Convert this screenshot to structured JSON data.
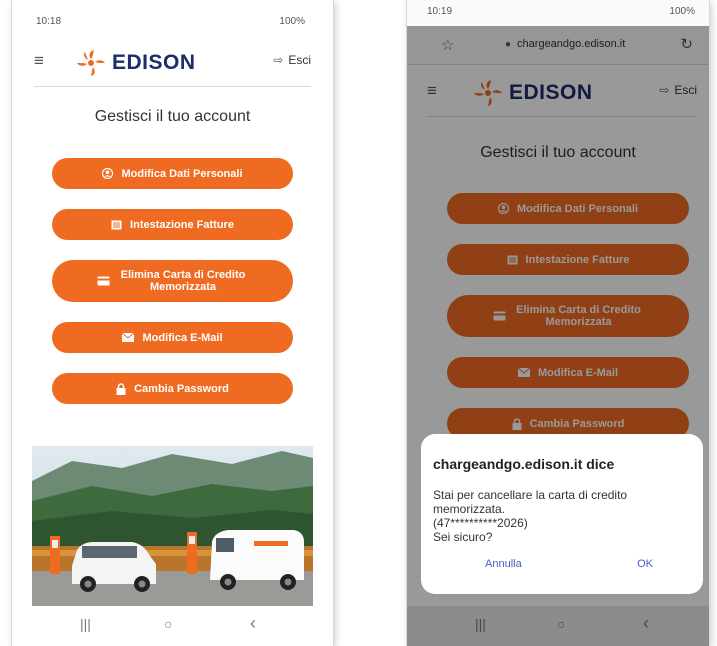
{
  "colors": {
    "accent": "#f06b22",
    "brand_blue": "#1a2d6c",
    "dialog_button": "#4a5bc4"
  },
  "left_phone": {
    "status_bar": {
      "time": "10:18",
      "battery": "100%"
    },
    "header": {
      "brand": "EDISON",
      "menu_icon": "hamburger-icon",
      "logout_label": "Esci",
      "logout_icon": "sign-out-icon"
    },
    "title": "Gestisci il tuo account",
    "buttons": [
      {
        "label": "Modifica Dati Personali",
        "icon": "user-icon"
      },
      {
        "label": "Intestazione Fatture",
        "icon": "invoice-icon"
      },
      {
        "label": "Elimina Carta di Credito Memorizzata",
        "icon": "credit-card-icon"
      },
      {
        "label": "Modifica E-Mail",
        "icon": "envelope-icon"
      },
      {
        "label": "Cambia Password",
        "icon": "lock-icon"
      }
    ],
    "nav": {
      "recent": "|||",
      "home": "○",
      "back": "‹"
    }
  },
  "right_phone": {
    "status_bar": {
      "time": "10:19",
      "battery": "100%"
    },
    "browser": {
      "url": "chargeandgo.edison.it"
    },
    "header": {
      "brand": "EDISON",
      "logout_label": "Esci"
    },
    "title": "Gestisci il tuo account",
    "buttons": [
      {
        "label": "Modifica Dati Personali",
        "icon": "user-icon"
      },
      {
        "label": "Intestazione Fatture",
        "icon": "invoice-icon"
      },
      {
        "label": "Elimina Carta di Credito Memorizzata",
        "icon": "credit-card-icon"
      },
      {
        "label": "Modifica E-Mail",
        "icon": "envelope-icon"
      },
      {
        "label": "Cambia Password",
        "icon": "lock-icon"
      }
    ],
    "dialog": {
      "title": "chargeandgo.edison.it dice",
      "message": "Stai per cancellare la carta di credito\nmemorizzata.\n(47**********2026)\nSei sicuro?",
      "cancel": "Annulla",
      "ok": "OK"
    },
    "nav": {
      "recent": "|||",
      "home": "○",
      "back": "‹"
    }
  }
}
